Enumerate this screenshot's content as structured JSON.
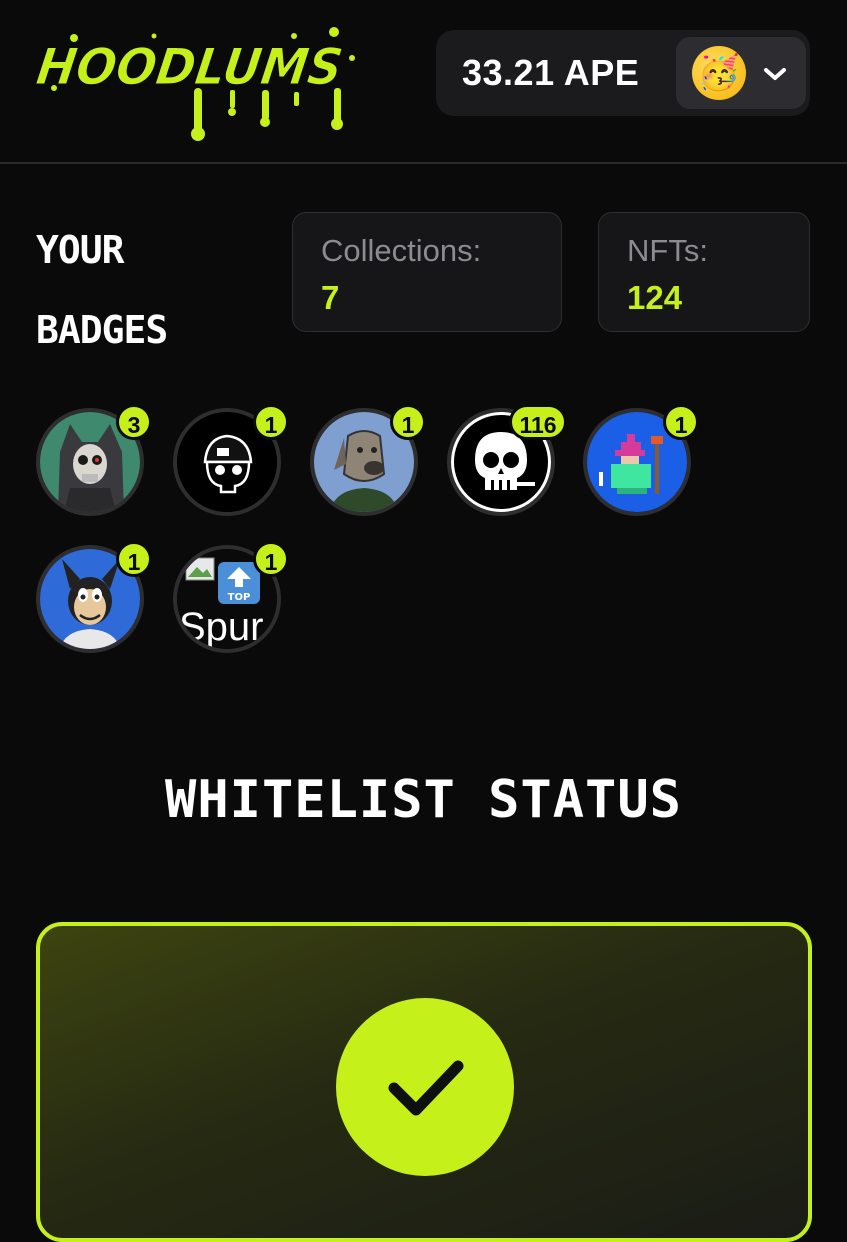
{
  "header": {
    "logo_text": "HOODLUMS",
    "wallet": {
      "balance": "33.21 APE",
      "avatar_emoji": "🥳"
    }
  },
  "badges_section": {
    "title_line1": "YOUR",
    "title_line2": "BADGES",
    "stats": {
      "collections_label": "Collections:",
      "collections_value": "7",
      "nfts_label": "NFTs:",
      "nfts_value": "124"
    },
    "badges": [
      {
        "image": "skeleton-wolf-hood",
        "count": "3"
      },
      {
        "image": "skull-beanie-logo",
        "count": "1"
      },
      {
        "image": "dog-portrait",
        "count": "1"
      },
      {
        "image": "smoking-skull-logo",
        "count": "116"
      },
      {
        "image": "pixel-wizard",
        "count": "1"
      },
      {
        "image": "cartoon-rabbit",
        "count": "1"
      },
      {
        "image": "broken-image-top",
        "count": "1",
        "alt_text": "Spur"
      }
    ]
  },
  "whitelist": {
    "title": "WHITELIST STATUS",
    "status_icon": "check-icon"
  },
  "colors": {
    "accent": "#c6f01a",
    "background": "#0a0a0b",
    "card": "#161618"
  }
}
